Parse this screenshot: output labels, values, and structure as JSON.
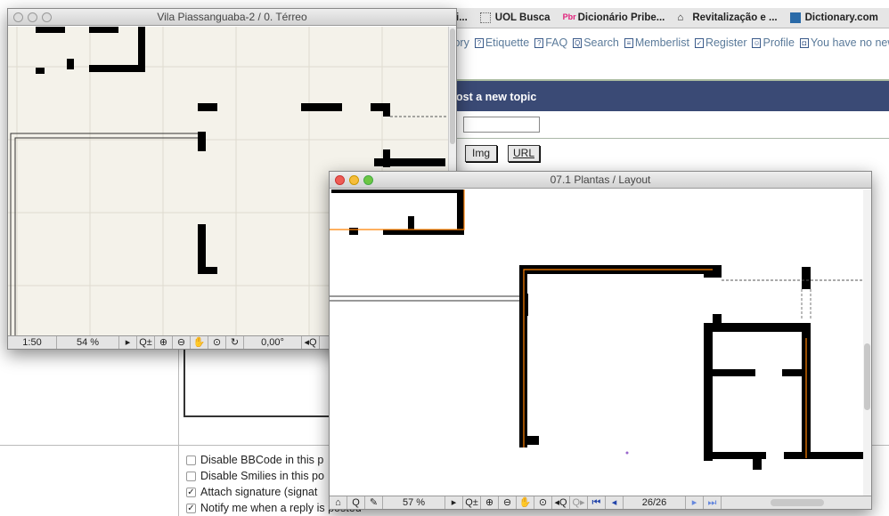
{
  "bookmarks": [
    {
      "label": "i...",
      "icon": "page-icon"
    },
    {
      "label": "UOL Busca",
      "icon": "dotted-box-icon"
    },
    {
      "label": "Dicionário Pribe...",
      "icon": "priberam-logo-icon"
    },
    {
      "label": "Revitalização e ...",
      "icon": "house-icon"
    },
    {
      "label": "Dictionary.com",
      "icon": "dictionary-logo-icon"
    }
  ],
  "nav": [
    {
      "label": "tory",
      "icon": ""
    },
    {
      "label": "Etiquette",
      "icon": "?"
    },
    {
      "label": "FAQ",
      "icon": "?"
    },
    {
      "label": "Search",
      "icon": "Q"
    },
    {
      "label": "Memberlist",
      "icon": "≡"
    },
    {
      "label": "Register",
      "icon": "✓"
    },
    {
      "label": "Profile",
      "icon": "☺"
    },
    {
      "label": "You have no new",
      "icon": "◘"
    }
  ],
  "post_header": "ost a new topic",
  "buttons": {
    "img": "Img",
    "url": "URL"
  },
  "options": [
    {
      "label": "Disable BBCode in this p",
      "checked": false
    },
    {
      "label": "Disable Smilies in this po",
      "checked": false
    },
    {
      "label": "Attach signature (signat",
      "checked": true
    },
    {
      "label": "Notify me when a reply is posted",
      "checked": true
    }
  ],
  "window1": {
    "title": "Vila Piassanguaba-2 / 0. Térreo",
    "scale": "1:50",
    "zoom": "54 %",
    "angle": "0,00°"
  },
  "window2": {
    "title": "07.1 Plantas / Layout",
    "zoom": "57 %",
    "page": "26/26"
  },
  "colors": {
    "header": "#3a4a75",
    "plan_bg": "#f4f2ea",
    "wall": "#000000",
    "wall_outline": "#ff8000"
  }
}
